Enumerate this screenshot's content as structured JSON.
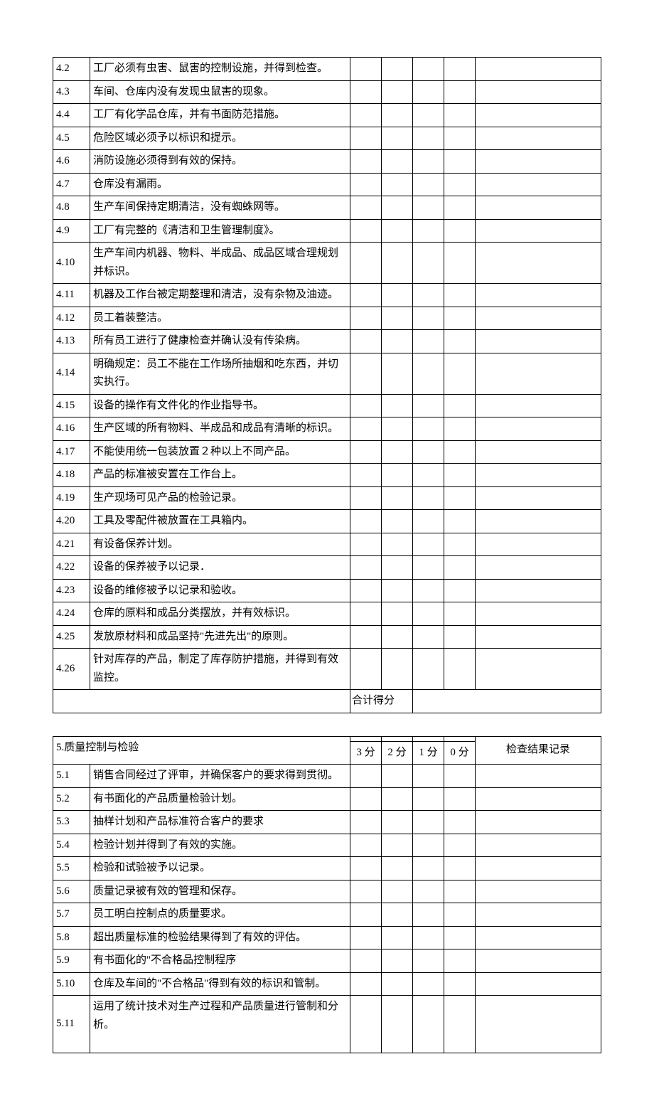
{
  "table4": {
    "rows": [
      {
        "num": "4.2",
        "desc": "工厂必须有虫害、鼠害的控制设施，并得到检查。"
      },
      {
        "num": "4.3",
        "desc": "车间、仓库内没有发现虫鼠害的现象。"
      },
      {
        "num": "4.4",
        "desc": "工厂有化学品仓库，并有书面防范措施。"
      },
      {
        "num": "4.5",
        "desc": "危险区域必须予以标识和提示。"
      },
      {
        "num": "4.6",
        "desc": "消防设施必须得到有效的保持。"
      },
      {
        "num": "4.7",
        "desc": "仓库没有漏雨。"
      },
      {
        "num": "4.8",
        "desc": "生产车间保持定期清洁，没有蜘蛛网等。"
      },
      {
        "num": "4.9",
        "desc": "工厂有完整的《清洁和卫生管理制度》。"
      },
      {
        "num": "4.10",
        "desc": "生产车间内机器、物料、半成品、成品区域合理规划并标识。"
      },
      {
        "num": "4.11",
        "desc": "机器及工作台被定期整理和清洁，没有杂物及油迹。"
      },
      {
        "num": "4.12",
        "desc": "员工着装整洁。"
      },
      {
        "num": "4.13",
        "desc": "所有员工进行了健康检查并确认没有传染病。"
      },
      {
        "num": "4.14",
        "desc": "明确规定：员工不能在工作场所抽烟和吃东西，并切实执行。"
      },
      {
        "num": "4.15",
        "desc": "设备的操作有文件化的作业指导书。"
      },
      {
        "num": "4.16",
        "desc": "生产区域的所有物料、半成品和成品有清晰的标识。"
      },
      {
        "num": "4.17",
        "desc": "不能使用统一包装放置２种以上不同产品。"
      },
      {
        "num": "4.18",
        "desc": "产品的标准被安置在工作台上。"
      },
      {
        "num": "4.19",
        "desc": "生产现场可见产品的检验记录。"
      },
      {
        "num": "4.20",
        "desc": "工具及零配件被放置在工具箱内。"
      },
      {
        "num": "4.21",
        "desc": "有设备保养计划。"
      },
      {
        "num": "4.22",
        "desc": "设备的保养被予以记录．"
      },
      {
        "num": "4.23",
        "desc": "设备的维修被予以记录和验收。"
      },
      {
        "num": "4.24",
        "desc": "仓库的原料和成品分类摆放，并有效标识。"
      },
      {
        "num": "4.25",
        "desc": "发放原材料和成品坚持\"先进先出\"的原则。"
      },
      {
        "num": "4.26",
        "desc": "针对库存的产品，制定了库存防护措施，并得到有效监控。"
      }
    ],
    "totalLabel": "合计得分"
  },
  "table5": {
    "title": "5.质量控制与检验",
    "scoreHeaders": [
      "3 分",
      "2 分",
      "1 分",
      "0 分"
    ],
    "resultHeader": "检查结果记录",
    "rows": [
      {
        "num": "5.1",
        "desc": "销售合同经过了评审，并确保客户的要求得到贯彻。"
      },
      {
        "num": "5.2",
        "desc": "有书面化的产品质量检验计划。"
      },
      {
        "num": "5.3",
        "desc": "抽样计划和产品标准符合客户的要求"
      },
      {
        "num": "5.4",
        "desc": "检验计划并得到了有效的实施。"
      },
      {
        "num": "5.5",
        "desc": "检验和试验被予以记录。"
      },
      {
        "num": "5.6",
        "desc": "质量记录被有效的管理和保存。"
      },
      {
        "num": "5.7",
        "desc": "员工明白控制点的质量要求。"
      },
      {
        "num": "5.8",
        "desc": "超出质量标准的检验结果得到了有效的评估。"
      },
      {
        "num": "5.9",
        "desc": "有书面化的\"不合格品控制程序"
      },
      {
        "num": "5.10",
        "desc": "仓库及车间的\"不合格品\"得到有效的标识和管制。"
      },
      {
        "num": "5.11",
        "desc": "运用了统计技术对生产过程和产品质量进行管制和分析。"
      }
    ]
  }
}
